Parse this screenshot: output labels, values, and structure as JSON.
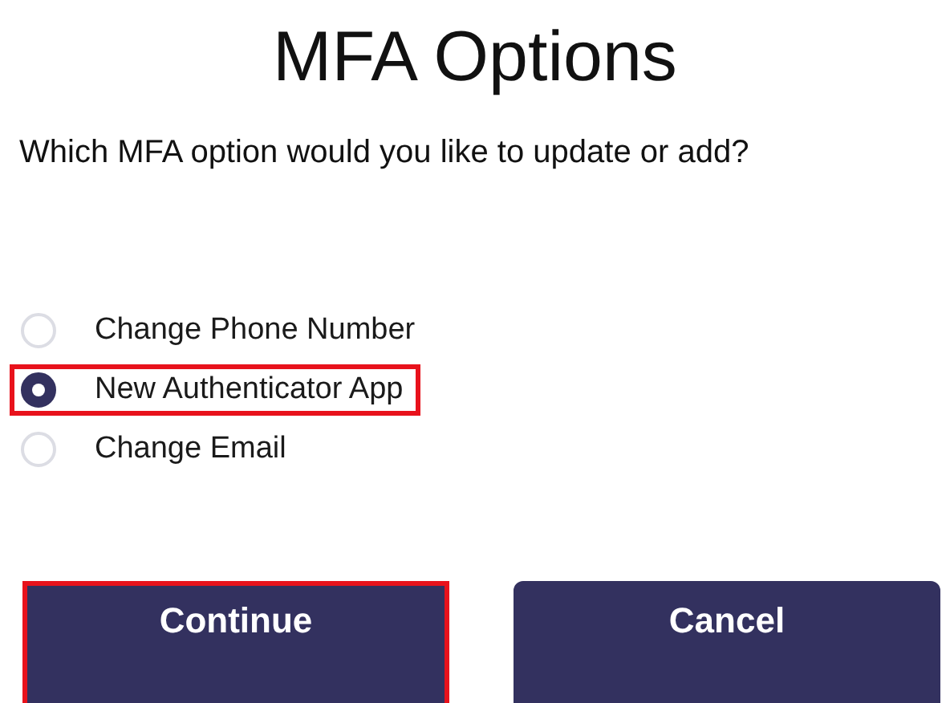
{
  "title": "MFA Options",
  "question": "Which MFA option would you like to update or add?",
  "options": [
    {
      "label": "Change Phone Number",
      "selected": false,
      "highlighted": false
    },
    {
      "label": "New Authenticator App",
      "selected": true,
      "highlighted": true
    },
    {
      "label": "Change Email",
      "selected": false,
      "highlighted": false
    }
  ],
  "buttons": [
    {
      "label": "Continue",
      "highlighted": true
    },
    {
      "label": "Cancel",
      "highlighted": false
    }
  ]
}
